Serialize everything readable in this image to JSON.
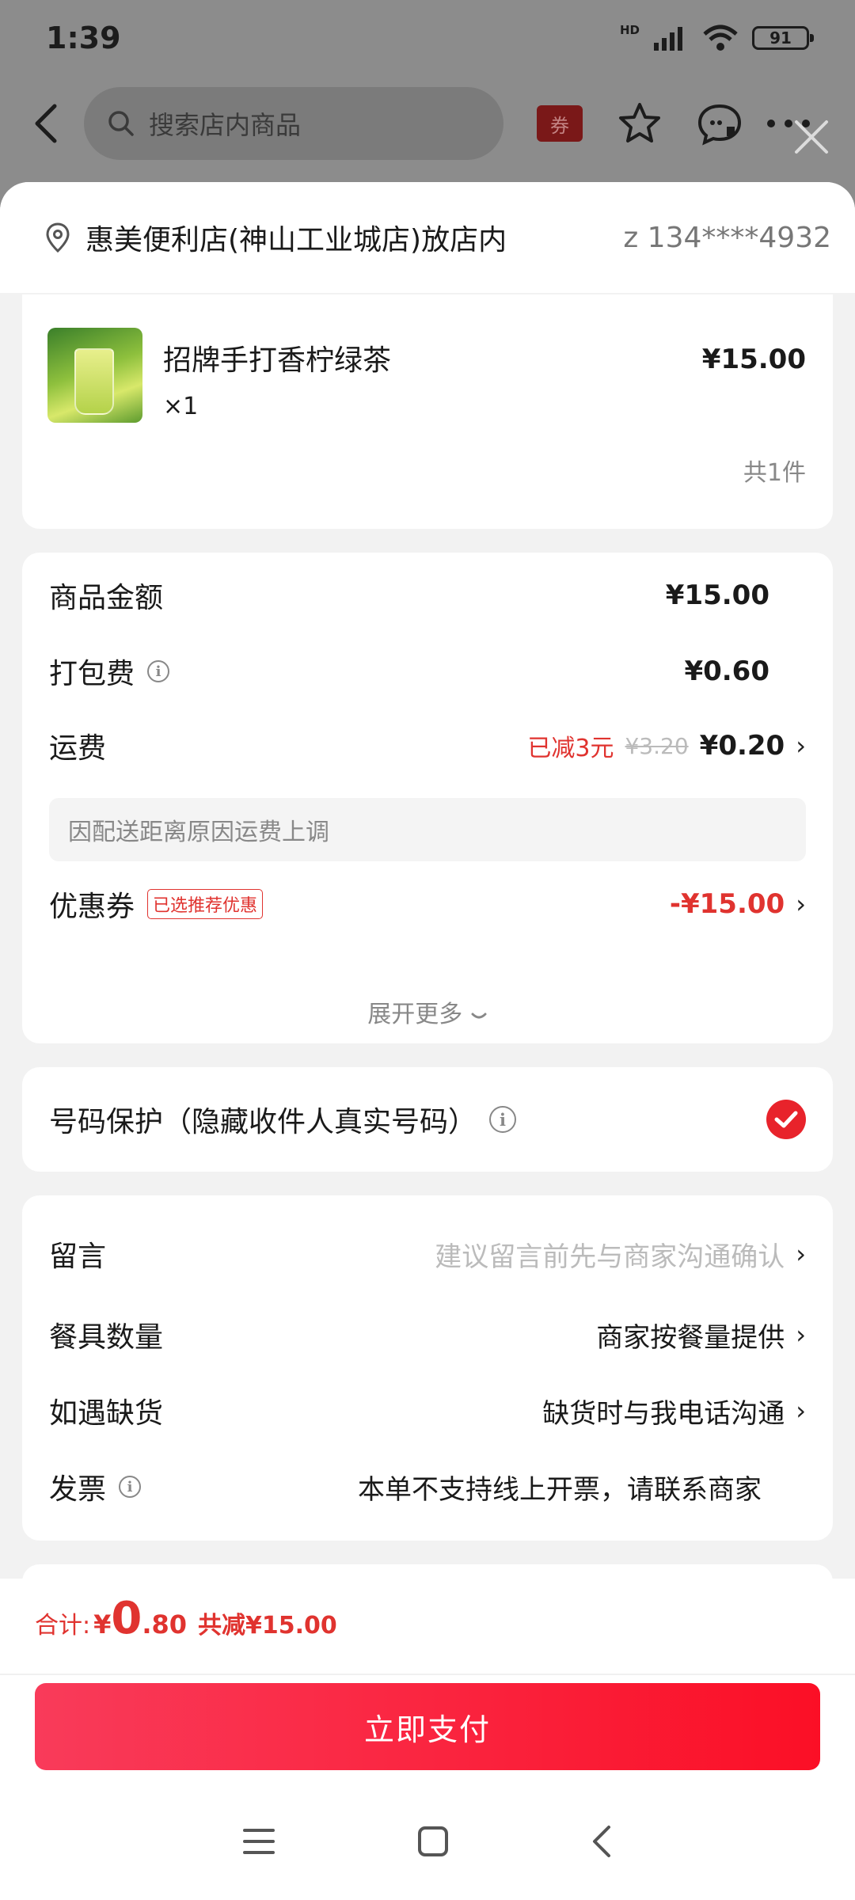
{
  "status_bar": {
    "time": "1:39",
    "network": "HD",
    "battery": "91"
  },
  "store_header": {
    "search_placeholder": "搜索店内商品",
    "coupon_label": "券"
  },
  "address": {
    "text": "惠美便利店(神山工业城店)放店内",
    "contact": "z  134****4932"
  },
  "product": {
    "name": "招牌手打香柠绿茶",
    "qty": "×1",
    "price": "¥15.00",
    "total_count": "共1件"
  },
  "fees": {
    "goods_label": "商品金额",
    "goods_value": "¥15.00",
    "packing_label": "打包费",
    "packing_value": "¥0.60",
    "delivery_label": "运费",
    "delivery_discount": "已减3元",
    "delivery_original": "¥3.20",
    "delivery_value": "¥0.20",
    "delivery_notice": "因配送距离原因运费上调",
    "coupon_label": "优惠券",
    "coupon_tag": "已选推荐优惠",
    "coupon_value": "-¥15.00",
    "expand_label": "展开更多"
  },
  "privacy": {
    "label": "号码保护（隐藏收件人真实号码）",
    "checked": true
  },
  "misc": {
    "note_label": "留言",
    "note_placeholder": "建议留言前先与商家沟通确认",
    "utensils_label": "餐具数量",
    "utensils_value": "商家按餐量提供",
    "stockout_label": "如遇缺货",
    "stockout_value": "缺货时与我电话沟通",
    "invoice_label": "发票",
    "invoice_value": "本单不支持线上开票，请联系商家"
  },
  "bottom": {
    "total_label": "合计:",
    "total_currency": "¥",
    "total_int": "0",
    "total_dec": ".80",
    "total_saved": "共减¥15.00",
    "pay_label": "立即支付"
  },
  "colors": {
    "accent": "#e0332f",
    "pay_button": "#fb0f26"
  }
}
